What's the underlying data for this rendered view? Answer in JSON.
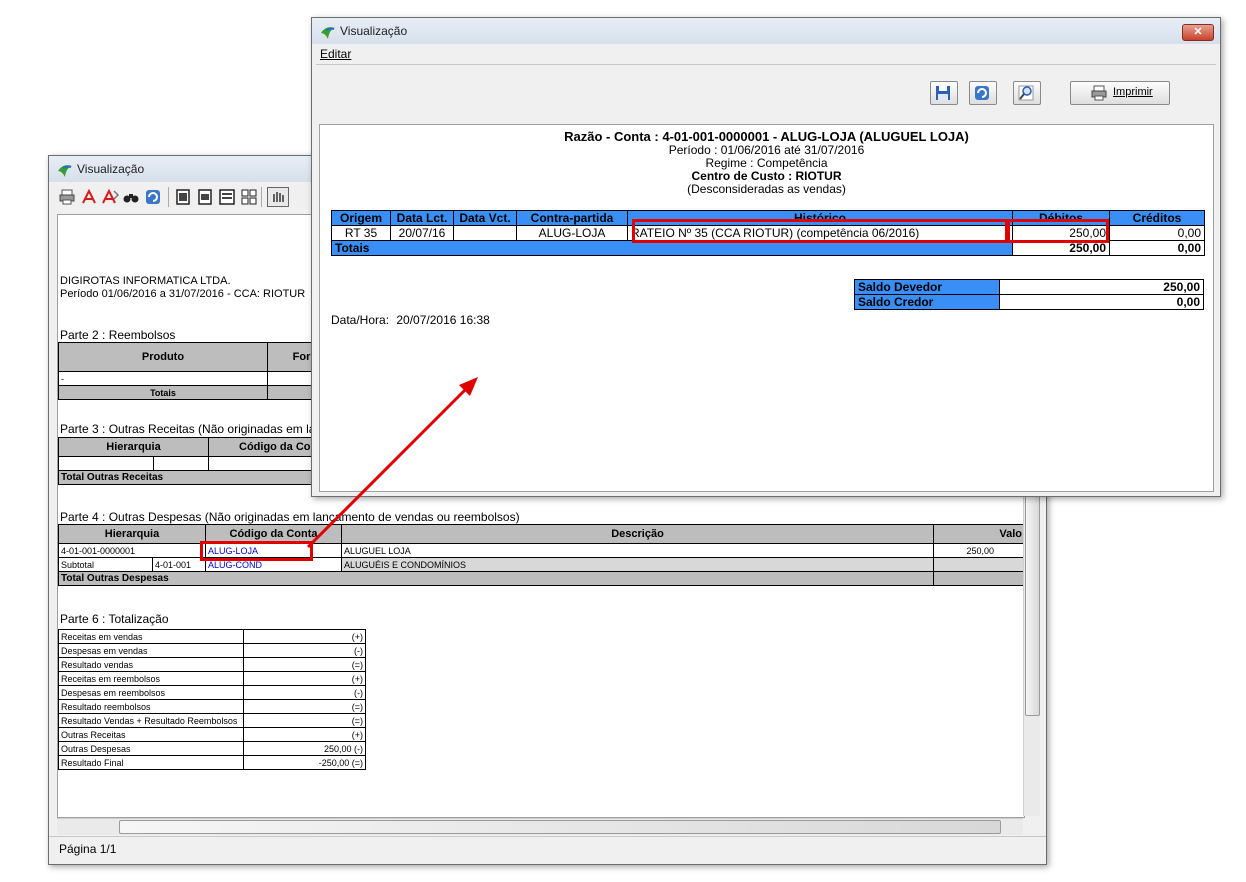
{
  "back": {
    "title": "Visualização",
    "company": "DIGIROTAS INFORMATICA LTDA.",
    "period": "Período 01/06/2016 a 31/07/2016  -  CCA: RIOTUR",
    "part2": {
      "title": "Parte 2 : Reembolsos",
      "col1": "Produto",
      "col2": "Forneci",
      "totals": "Totais"
    },
    "part3": {
      "title": "Parte 3 : Outras Receitas (Não originadas em la",
      "col1": "Hierarquia",
      "col2": "Código da Conta",
      "total": "Total Outras Receitas"
    },
    "part4": {
      "title": "Parte 4 : Outras Despesas (Não originadas em lançamento de vendas ou reembolsos)",
      "headers": [
        "Hierarquia",
        "Código da Conta",
        "Descrição",
        "Valo"
      ],
      "rows": [
        {
          "hier": "4-01-001-0000001",
          "code": "ALUG-LOJA",
          "desc": "ALUGUEL LOJA",
          "val": "250,00"
        },
        {
          "hier": "Subtotal",
          "hier2": "4-01-001",
          "code": "ALUG-COND",
          "desc": "ALUGUÉIS E CONDOMÍNIOS",
          "val": ""
        }
      ],
      "total": "Total Outras Despesas"
    },
    "part6": {
      "title": "Parte 6 : Totalização",
      "rows": [
        {
          "label": "Receitas em vendas",
          "val": "(+)"
        },
        {
          "label": "Despesas em vendas",
          "val": "(-)"
        },
        {
          "label": "Resultado vendas",
          "val": "(=)"
        },
        {
          "label": "Receitas em reembolsos",
          "val": "(+)"
        },
        {
          "label": "Despesas em reembolsos",
          "val": "(-)"
        },
        {
          "label": "Resultado reembolsos",
          "val": "(=)"
        },
        {
          "label": "Resultado Vendas + Resultado Reembolsos",
          "val": "(=)"
        },
        {
          "label": "Outras Receitas",
          "val": "(+)"
        },
        {
          "label": "Outras Despesas",
          "val": "250,00 (-)"
        },
        {
          "label": "Resultado Final",
          "val": "-250,00 (=)"
        }
      ]
    },
    "status": "Página 1/1"
  },
  "front": {
    "title": "Visualização",
    "menu": "Editar",
    "print_label": "Imprimir",
    "report": {
      "line1": "Razão - Conta : 4-01-001-0000001 - ALUG-LOJA (ALUGUEL LOJA)",
      "line2": "Período : 01/06/2016 até 31/07/2016",
      "line3": "Regime : Competência",
      "line4": "Centro de Custo : RIOTUR",
      "line5": "(Desconsideradas as vendas)"
    },
    "table": {
      "headers": [
        "Origem",
        "Data Lct.",
        "Data Vct.",
        "Contra-partida",
        "Histórico",
        "Débitos",
        "Créditos"
      ],
      "row": {
        "origem": "RT 35",
        "data_lct": "20/07/16",
        "data_vct": "",
        "contra": "ALUG-LOJA",
        "historico": "RATEIO Nº 35 (CCA RIOTUR) (competência 06/2016)",
        "debitos": "250,00",
        "creditos": "0,00"
      },
      "totals_label": "Totais",
      "totals_deb": "250,00",
      "totals_cred": "0,00"
    },
    "saldo": {
      "devedor_label": "Saldo Devedor",
      "devedor_val": "250,00",
      "credor_label": "Saldo Credor",
      "credor_val": "0,00"
    },
    "datetime_label": "Data/Hora:",
    "datetime_val": "20/07/2016 16:38"
  },
  "colors": {
    "header_blue": "#3a8ff6",
    "highlight_red": "#e00000"
  }
}
